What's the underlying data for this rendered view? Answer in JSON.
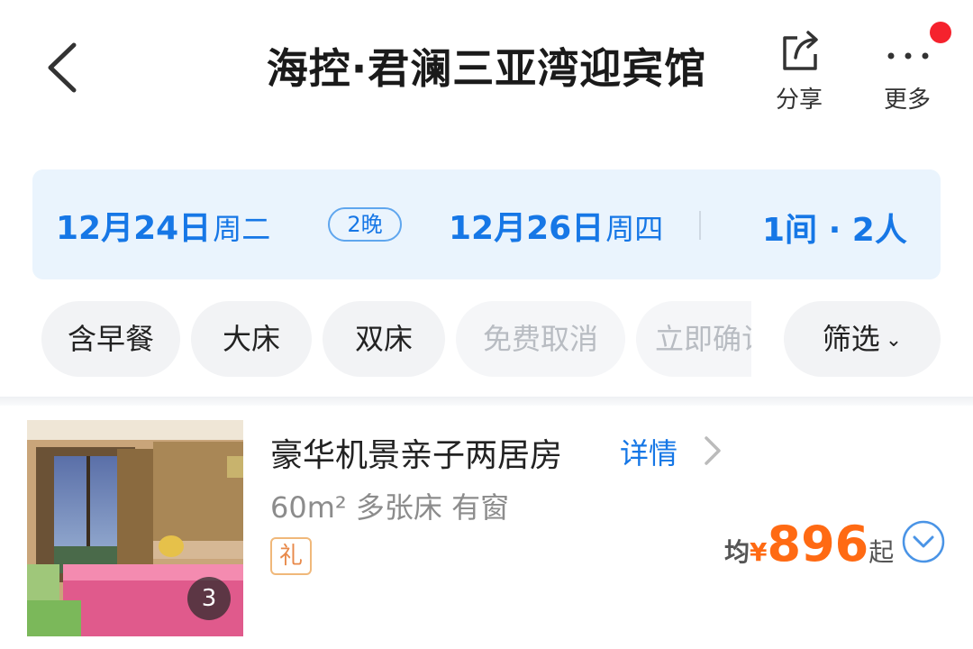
{
  "header": {
    "title": "海控·君澜三亚湾迎宾馆",
    "share_label": "分享",
    "more_label": "更多",
    "icons": {
      "back": "back-arrow-icon",
      "share": "share-icon",
      "more": "more-dots-icon",
      "notify": "notification-dot"
    }
  },
  "date_bar": {
    "check_in": "12月24日",
    "check_in_weekday": "周二",
    "nights": "2晚",
    "check_out": "12月26日",
    "check_out_weekday": "周四",
    "guests": "1间 · 2人"
  },
  "filters": {
    "chips": [
      {
        "label": "含早餐",
        "enabled": true
      },
      {
        "label": "大床",
        "enabled": true
      },
      {
        "label": "双床",
        "enabled": true
      },
      {
        "label": "免费取消",
        "enabled": false
      },
      {
        "label": "立即确认",
        "enabled": false
      }
    ],
    "filter_label": "筛选"
  },
  "room": {
    "name": "豪华机景亲子两居房",
    "detail_label": "详情",
    "info": "60m² 多张床 有窗",
    "gift_badge": "礼",
    "photo_count": "3",
    "price_prefix": "均",
    "currency": "¥",
    "price": "896",
    "price_suffix": "起"
  },
  "colors": {
    "accent": "#1677e6",
    "price": "#ff6a13",
    "date_bar_bg": "#eaf4fd",
    "notify_dot": "#f5222d"
  }
}
